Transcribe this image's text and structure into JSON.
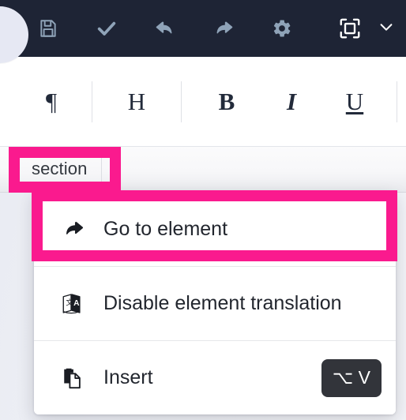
{
  "theme": {
    "toolbar_bg": "#1e2435",
    "toolbar_icon": "#8fa3b8",
    "toolbar_icon_active": "#ffffff",
    "highlight": "#fa1a8e",
    "menu_bg": "#ffffff",
    "shortcut_bg": "#32343a",
    "page_bg": "#eef0f5"
  },
  "left_panel_handle": {
    "name": "collapsed-panel-handle"
  },
  "top_toolbar": {
    "items": [
      {
        "id": "save",
        "icon": "save-icon",
        "label": "Save"
      },
      {
        "id": "confirm",
        "icon": "check-icon",
        "label": "Confirm"
      },
      {
        "id": "undo",
        "icon": "undo-icon",
        "label": "Undo"
      },
      {
        "id": "redo",
        "icon": "redo-icon",
        "label": "Redo"
      },
      {
        "id": "settings",
        "icon": "gear-icon",
        "label": "Settings"
      },
      {
        "id": "fullscreen",
        "icon": "fullscreen-icon",
        "label": "Fullscreen"
      }
    ],
    "chevron": {
      "icon": "chevron-down-icon",
      "label": "More"
    }
  },
  "format_toolbar": {
    "items": [
      {
        "id": "paragraph",
        "label": "¶",
        "name": "paragraph-button"
      },
      {
        "id": "heading",
        "label": "H",
        "name": "heading-button"
      },
      {
        "id": "bold",
        "label": "B",
        "name": "bold-button"
      },
      {
        "id": "italic",
        "label": "I",
        "name": "italic-button"
      },
      {
        "id": "underline",
        "label": "U",
        "name": "underline-button"
      }
    ]
  },
  "tab_bar": {
    "tabs": [
      {
        "id": "section",
        "label": "section",
        "active": true
      }
    ]
  },
  "context_menu": {
    "items": [
      {
        "id": "go-to-element",
        "label": "Go to element",
        "icon": "arrow-redo-icon",
        "shortcut": null,
        "highlighted": true
      },
      {
        "id": "disable-element-translation",
        "label": "Disable element translation",
        "icon": "translate-icon",
        "shortcut": null,
        "highlighted": false
      },
      {
        "id": "insert",
        "label": "Insert",
        "icon": "paste-icon",
        "shortcut": "⌥ V",
        "highlighted": false
      }
    ]
  },
  "annotations": [
    {
      "id": "tab-highlight",
      "target": "section tab",
      "color": "#fa1a8e"
    },
    {
      "id": "menu-item-highlight",
      "target": "Go to element",
      "color": "#fa1a8e"
    }
  ]
}
